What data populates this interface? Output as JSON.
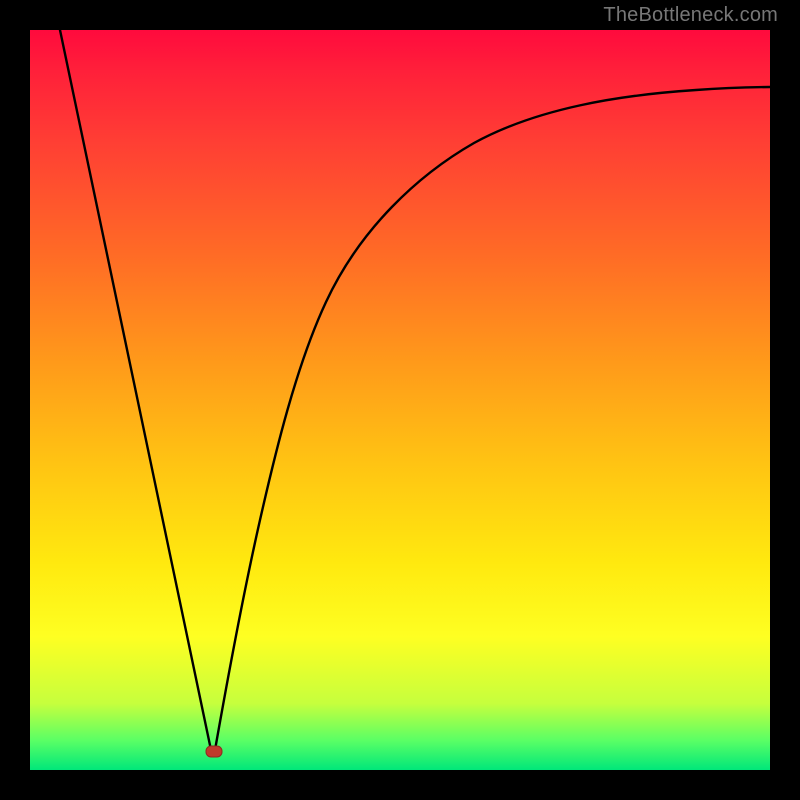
{
  "watermark": "TheBottleneck.com",
  "chart_data": {
    "type": "line",
    "title": "",
    "xlabel": "",
    "ylabel": "",
    "xlim": [
      0,
      100
    ],
    "ylim": [
      0,
      100
    ],
    "grid": false,
    "legend": false,
    "series": [
      {
        "name": "left-branch",
        "x": [
          4,
          24.5
        ],
        "y": [
          100,
          2.5
        ]
      },
      {
        "name": "right-branch",
        "x": [
          25,
          27,
          29,
          31,
          34,
          38,
          43,
          50,
          58,
          66,
          74,
          82,
          90,
          100
        ],
        "y": [
          2.5,
          14,
          25,
          34,
          44,
          55,
          64,
          73,
          80,
          84.5,
          87.5,
          89.5,
          91,
          92.3
        ]
      }
    ],
    "annotations": [
      {
        "name": "minimum-marker",
        "x": 24.7,
        "y": 2.5,
        "shape": "rounded-rect",
        "color": "#c0392b"
      }
    ],
    "colors": {
      "curve": "#000000",
      "background_top": "#ff0a3d",
      "background_bottom": "#00e77a",
      "frame": "#000000",
      "marker": "#c0392b"
    }
  }
}
